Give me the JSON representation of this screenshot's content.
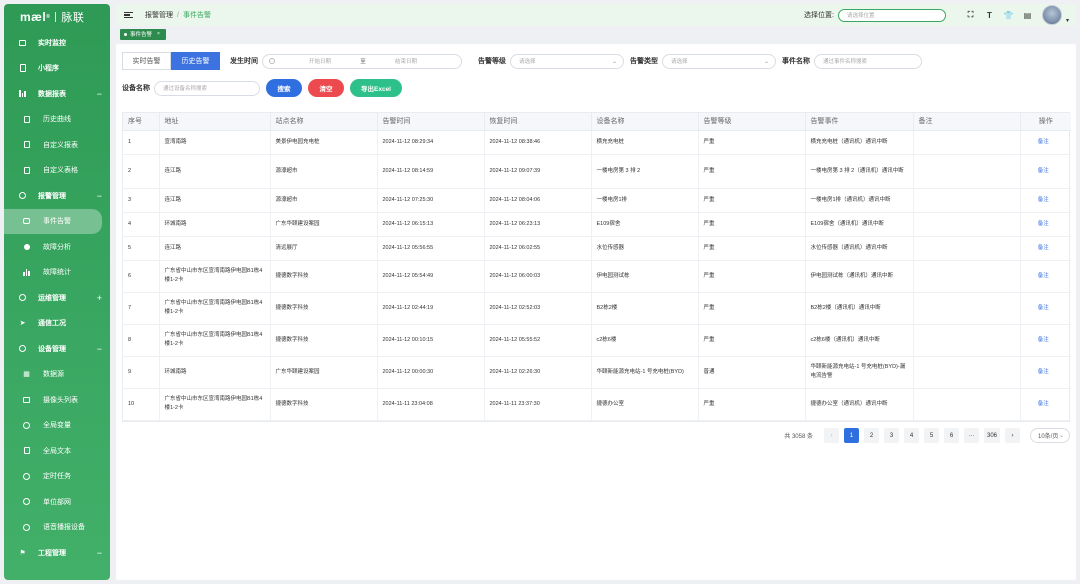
{
  "brand": {
    "logo": "mæl",
    "sup": "®",
    "cn": "脉联"
  },
  "sidebar": {
    "items": [
      {
        "label": "实时监控",
        "icon": "monitor-icon",
        "level": 0
      },
      {
        "label": "小程序",
        "icon": "mobile-icon",
        "level": 0
      },
      {
        "label": "数据报表",
        "icon": "report-icon",
        "level": 0,
        "toggle": "−"
      },
      {
        "label": "历史曲线",
        "icon": "curve-icon",
        "level": 1
      },
      {
        "label": "自定义报表",
        "icon": "custom-report-icon",
        "level": 1
      },
      {
        "label": "自定义表格",
        "icon": "custom-table-icon",
        "level": 1
      },
      {
        "label": "报警管理",
        "icon": "alarm-icon",
        "level": 0,
        "toggle": "−"
      },
      {
        "label": "事件告警",
        "icon": "event-icon",
        "level": 1,
        "active": true
      },
      {
        "label": "故障分析",
        "icon": "fault-analysis-icon",
        "level": 1
      },
      {
        "label": "故障统计",
        "icon": "fault-stats-icon",
        "level": 1
      },
      {
        "label": "运维管理",
        "icon": "ops-icon",
        "level": 0,
        "toggle": "+"
      },
      {
        "label": "通信工况",
        "icon": "send-icon",
        "level": 0
      },
      {
        "label": "设备管理",
        "icon": "device-icon",
        "level": 0,
        "toggle": "−"
      },
      {
        "label": "数据源",
        "icon": "datasource-icon",
        "level": 1
      },
      {
        "label": "摄像头列表",
        "icon": "camera-icon",
        "level": 1
      },
      {
        "label": "全局变量",
        "icon": "global-var-icon",
        "level": 1
      },
      {
        "label": "全局文本",
        "icon": "global-text-icon",
        "level": 1
      },
      {
        "label": "定时任务",
        "icon": "timer-icon",
        "level": 1
      },
      {
        "label": "单位部网",
        "icon": "unit-icon",
        "level": 1
      },
      {
        "label": "语音播报设备",
        "icon": "voice-icon",
        "level": 1
      },
      {
        "label": "工程管理",
        "icon": "flag-icon",
        "level": 0,
        "toggle": "−"
      }
    ]
  },
  "header": {
    "breadcrumb": [
      "报警管理",
      "事件告警"
    ],
    "location_label": "选择位置:",
    "location_placeholder": "请选择位置"
  },
  "tag": {
    "label": "事件告警",
    "close": "×"
  },
  "filters": {
    "tabs": [
      {
        "label": "实时告警",
        "active": false
      },
      {
        "label": "历史告警",
        "active": true
      }
    ],
    "time_label": "发生时间",
    "start_placeholder": "开始日期",
    "range_sep": "至",
    "end_placeholder": "结束日期",
    "level_label": "告警等级",
    "level_placeholder": "请选择",
    "type_label": "告警类型",
    "type_placeholder": "请选择",
    "event_label": "事件名称",
    "event_placeholder": "通过事件名称搜索",
    "device_label": "设备名称",
    "device_placeholder": "通过设备名称搜索",
    "search_btn": "搜索",
    "clear_btn": "清空",
    "export_btn": "导出Excel"
  },
  "table": {
    "columns": [
      "序号",
      "地址",
      "站点名称",
      "告警时间",
      "恢复时间",
      "设备名称",
      "告警等级",
      "告警事件",
      "备注",
      "操作"
    ],
    "rows": [
      [
        "1",
        "宣湾南路",
        "美景伊电园充电桩",
        "2024-11-12 08:29:34",
        "2024-11-12 08:38:46",
        "横充充电桩",
        "严重",
        "横充充电桩（通讯机）通讯中断",
        "",
        "备注"
      ],
      [
        "2",
        "连江路",
        "源濠超市",
        "2024-11-12 08:14:59",
        "2024-11-12 09:07:39",
        "一楼电房第 3 排 2",
        "严重",
        "一楼电房第 3 排 2（通讯机）通讯中断",
        "",
        "备注"
      ],
      [
        "3",
        "连江路",
        "源濠超市",
        "2024-11-12 07:25:30",
        "2024-11-12 08:04:06",
        "一楼电房1排",
        "严重",
        "一楼电房1排（通讯机）通讯中断",
        "",
        "备注"
      ],
      [
        "4",
        "环城南路",
        "广东华颐建设案园",
        "2024-11-12 06:15:13",
        "2024-11-12 06:23:13",
        "E109宿舍",
        "严重",
        "E109宿舍（通讯机）通讯中断",
        "",
        "备注"
      ],
      [
        "5",
        "连江路",
        "清远展厅",
        "2024-11-12 05:56:55",
        "2024-11-12 06:02:55",
        "水位传感器",
        "严重",
        "水位传感器（通讯机）通讯中断",
        "",
        "备注"
      ],
      [
        "6",
        "广东省中山市东区宣湾南路伊电园B1栋4楼1-2卡",
        "捷德数字科技",
        "2024-11-12 05:54:49",
        "2024-11-12 06:00:03",
        "伊电园测试栋",
        "严重",
        "伊电园测试栋（通讯机）通讯中断",
        "",
        "备注"
      ],
      [
        "7",
        "广东省中山市东区宣湾南路伊电园B1栋4楼1-2卡",
        "捷德数字科技",
        "2024-11-12 02:44:19",
        "2024-11-12 02:52:03",
        "B2栋2楼",
        "严重",
        "B2栋2楼（通讯机）通讯中断",
        "",
        "备注"
      ],
      [
        "8",
        "广东省中山市东区宣湾南路伊电园B1栋4楼1-2卡",
        "捷德数字科技",
        "2024-11-12 00:10:15",
        "2024-11-12 05:55:52",
        "c2栋6楼",
        "严重",
        "c2栋6楼（通讯机）通讯中断",
        "",
        "备注"
      ],
      [
        "9",
        "环城南路",
        "广东华颐建设案园",
        "2024-11-12 00:00:30",
        "2024-11-12 02:26:30",
        "华颐新能源充电站-1 号充电桩(BYD)",
        "普通",
        "华颐新能源充电站-1 号充电桩(BYD)-漏电流告警",
        "",
        "备注"
      ],
      [
        "10",
        "广东省中山市东区宣湾南路伊电园B1栋4楼1-2卡",
        "捷德数字科技",
        "2024-11-11 23:04:08",
        "2024-11-11 23:37:30",
        "捷德办公室",
        "严重",
        "捷德办公室（通讯机）通讯中断",
        "",
        "备注"
      ]
    ]
  },
  "pagination": {
    "total": "共 3058 条",
    "prev": "‹",
    "pages": [
      "1",
      "2",
      "3",
      "4",
      "5",
      "6",
      "···",
      "306"
    ],
    "next": "›",
    "page_size": "10条/页"
  }
}
